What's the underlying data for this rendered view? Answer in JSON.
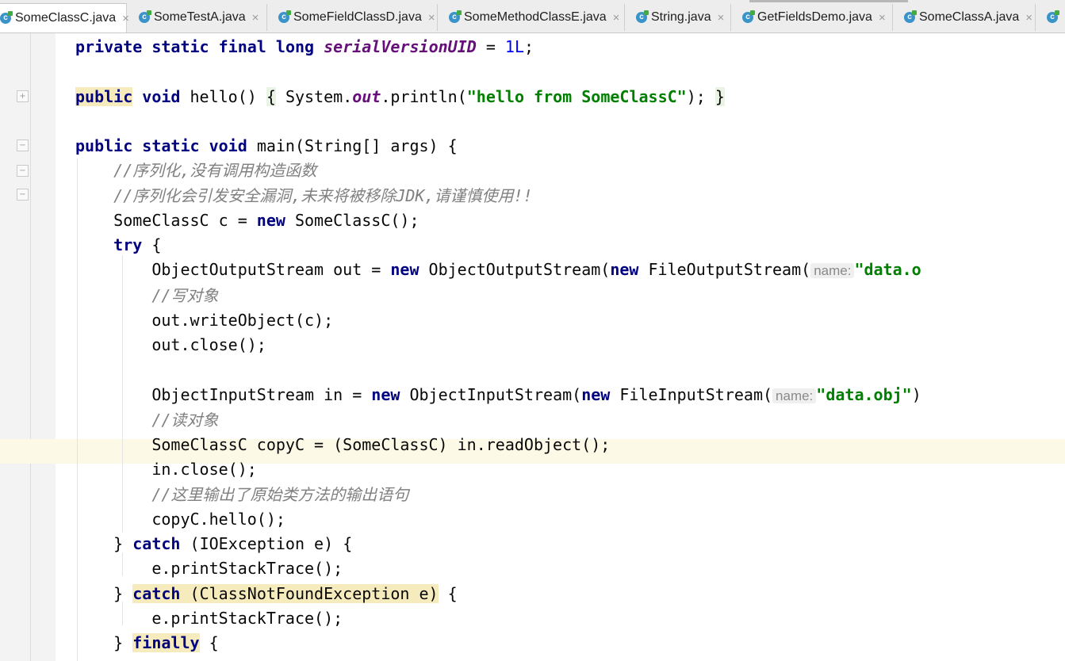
{
  "tabs": [
    {
      "label": "SomeClassC.java",
      "active": true
    },
    {
      "label": "SomeTestA.java",
      "active": false
    },
    {
      "label": "SomeFieldClassD.java",
      "active": false
    },
    {
      "label": "SomeMethodClassE.java",
      "active": false
    },
    {
      "label": "String.java",
      "active": false
    },
    {
      "label": "GetFieldsDemo.java",
      "active": false
    },
    {
      "label": "SomeClassA.java",
      "active": false
    }
  ],
  "icons": {
    "class_icon": "c-class-icon",
    "tab_close": "×",
    "fold_expand": "+",
    "fold_collapse": "−",
    "bulb": "lightbulb-icon"
  },
  "editor": {
    "private_kw": "private",
    "static_kw": "static",
    "final_kw": "final",
    "long_kw": "long",
    "serial_field": "serialVersionUID",
    "eq": " = ",
    "serial_value": "1L",
    "semi": ";",
    "public_kw": "public",
    "void_kw": "void",
    "hello_sig": "hello()",
    "open_brace": "{",
    "close_brace": "}",
    "system_text": "System.",
    "out_field": "out",
    "println_text": ".println(",
    "hello_string": "\"hello from SomeClassC\"",
    "close_paren_semi": ");",
    "main_sig": "main(String[] args) ",
    "comment1": "//序列化,没有调用构造函数",
    "comment2": "//序列化会引发安全漏洞,未来将被移除JDK,请谨慎使用!!",
    "new_c_decl": "SomeClassC c = ",
    "new_kw": "new",
    "new_c_ctor": "SomeClassC();",
    "try_kw": "try",
    "oos_decl": "ObjectOutputStream out = ",
    "oos_ctor": "ObjectOutputStream(",
    "fos_ctor": "FileOutputStream(",
    "param_hint": "name:",
    "fos_arg": "\"data.o",
    "comment_write": "//写对象",
    "write_call": "out.writeObject(c);",
    "out_close": "out.close();",
    "ois_decl": "ObjectInputStream in = ",
    "ois_ctor": "ObjectInputStream(",
    "fis_ctor": "FileInputStream(",
    "fis_arg": "\"data.obj\"",
    "fis_tail": ")",
    "comment_read": "//读对象",
    "copy_decl": "SomeClassC copyC = (SomeClassC) in.readObject();",
    "in_close": "in.close();",
    "comment_output": "//这里输出了原始类方法的输出语句",
    "copy_hello": "copyC.hello();",
    "catch_kw": "catch",
    "catch1_args": " (IOException e) ",
    "print_trace": "e.printStackTrace();",
    "catch2_args": " (ClassNotFoundException e)",
    "finally_kw": "finally"
  }
}
